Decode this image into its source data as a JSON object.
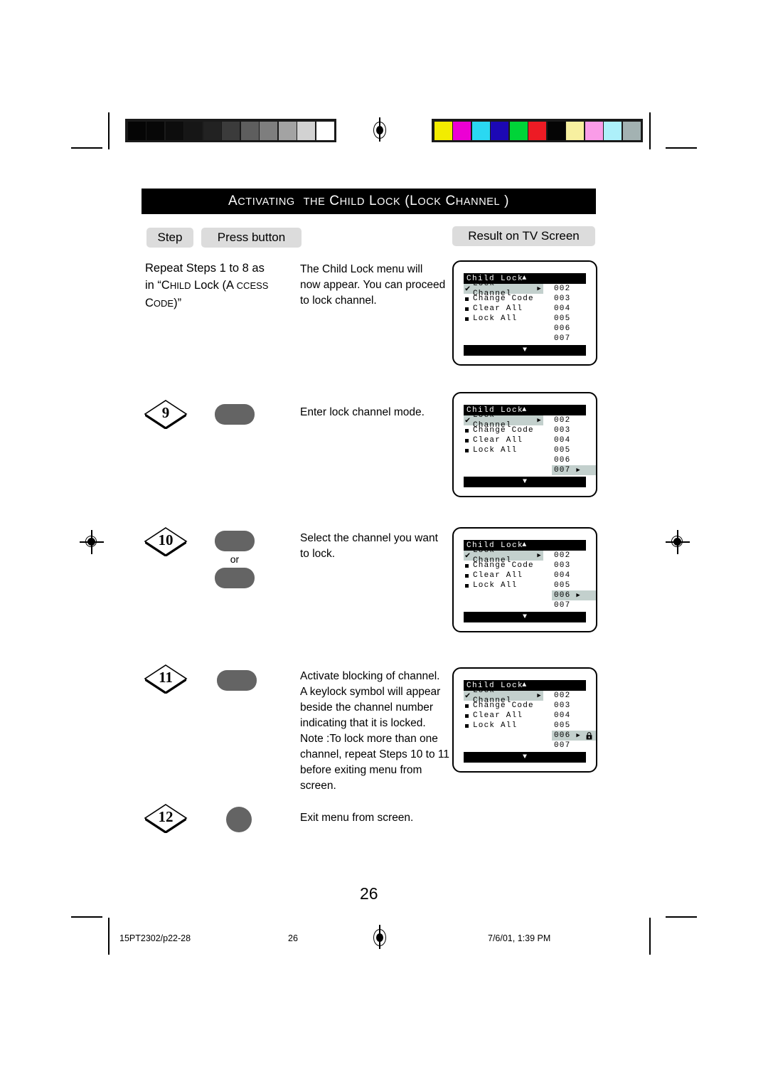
{
  "document": {
    "page_number": "26",
    "footer": {
      "file_ref": "15PT2302/p22-28",
      "page": "26",
      "timestamp": "7/6/01, 1:39 PM"
    }
  },
  "header": {
    "title_parts": {
      "a": "A",
      "ctivating": "CTIVATING",
      "the_big": "T",
      "the_small": "HE",
      "c1": "C",
      "hild": "HILD",
      "l1": "L",
      "ock": "OCK",
      "paren_open": "(",
      "l2": "L",
      "ock2": "OCK",
      "c2": "C",
      "hannel": "HANNEL",
      "paren_close": ")"
    },
    "title_plain": "ACTIVATING THE CHILD LOCK (LOCK CHANNEL )"
  },
  "columns": {
    "step_label": "Step",
    "press_button_label": "Press button",
    "result_label": "Result on TV Screen"
  },
  "calibration": {
    "grayscale": [
      "#050505",
      "#070707",
      "#0d0d0d",
      "#161616",
      "#222222",
      "#3b3b3b",
      "#5e5e5e",
      "#7e7e7e",
      "#a3a3a3",
      "#d2d2d2",
      "#ffffff"
    ],
    "colors": [
      "#f2ec00",
      "#ec00d4",
      "#2ad8f2",
      "#1c08b4",
      "#00d438",
      "#ed1b24",
      "#050505",
      "#f7f0a0",
      "#fa9ce8",
      "#adf0fa",
      "#a3b2b2"
    ]
  },
  "rows": [
    {
      "step_number": "",
      "instruction_line1": "Repeat Steps 1 to 8 as",
      "instruction_line2_pre": "in “",
      "instruction_child_c": "C",
      "instruction_child_hild": "HILD",
      "instruction_lock": " Lock (A ",
      "instruction_access": "CCESS",
      "instruction_code_c": "C",
      "instruction_code_ode": "ODE",
      "instruction_code_close": ")”",
      "description": "The Child Lock menu will\nnow appear. You can proceed\nto lock channel.",
      "button": "none",
      "tv": {
        "title": "Child Lock",
        "up_arrow": "▲",
        "down_arrow": "▼",
        "menu_items": [
          {
            "label": "Lock Channel",
            "marker": "check",
            "highlighted": true,
            "arrow": true
          },
          {
            "label": "Change Code",
            "marker": "bullet",
            "highlighted": false,
            "arrow": false
          },
          {
            "label": "Clear All",
            "marker": "bullet",
            "highlighted": false,
            "arrow": false
          },
          {
            "label": "Lock All",
            "marker": "bullet",
            "highlighted": false,
            "arrow": false
          }
        ],
        "channels": [
          {
            "value": "002",
            "highlighted": false,
            "arrow": false,
            "lock": false
          },
          {
            "value": "003",
            "highlighted": false,
            "arrow": false,
            "lock": false
          },
          {
            "value": "004",
            "highlighted": false,
            "arrow": false,
            "lock": false
          },
          {
            "value": "005",
            "highlighted": false,
            "arrow": false,
            "lock": false
          },
          {
            "value": "006",
            "highlighted": false,
            "arrow": false,
            "lock": false
          },
          {
            "value": "007",
            "highlighted": false,
            "arrow": false,
            "lock": false
          }
        ]
      }
    },
    {
      "step_number": "9",
      "description": "Enter lock channel mode.",
      "button": "pill",
      "tv": {
        "title": "Child Lock",
        "up_arrow": "▲",
        "down_arrow": "▼",
        "menu_items": [
          {
            "label": "Lock Channel",
            "marker": "check",
            "highlighted": true,
            "arrow": true
          },
          {
            "label": "Change Code",
            "marker": "bullet",
            "highlighted": false,
            "arrow": false
          },
          {
            "label": "Clear All",
            "marker": "bullet",
            "highlighted": false,
            "arrow": false
          },
          {
            "label": "Lock All",
            "marker": "bullet",
            "highlighted": false,
            "arrow": false
          }
        ],
        "channels": [
          {
            "value": "002",
            "highlighted": false,
            "arrow": false,
            "lock": false
          },
          {
            "value": "003",
            "highlighted": false,
            "arrow": false,
            "lock": false
          },
          {
            "value": "004",
            "highlighted": false,
            "arrow": false,
            "lock": false
          },
          {
            "value": "005",
            "highlighted": false,
            "arrow": false,
            "lock": false
          },
          {
            "value": "006",
            "highlighted": false,
            "arrow": false,
            "lock": false
          },
          {
            "value": "007",
            "highlighted": true,
            "arrow": true,
            "lock": false
          }
        ]
      }
    },
    {
      "step_number": "10",
      "description": "Select the channel you want\nto lock.",
      "button": "pill-or-pill",
      "or_label": "or",
      "tv": {
        "title": "Child Lock",
        "up_arrow": "▲",
        "down_arrow": "▼",
        "menu_items": [
          {
            "label": "Lock Channel",
            "marker": "check",
            "highlighted": true,
            "arrow": true
          },
          {
            "label": "Change Code",
            "marker": "bullet",
            "highlighted": false,
            "arrow": false
          },
          {
            "label": "Clear All",
            "marker": "bullet",
            "highlighted": false,
            "arrow": false
          },
          {
            "label": "Lock All",
            "marker": "bullet",
            "highlighted": false,
            "arrow": false
          }
        ],
        "channels": [
          {
            "value": "002",
            "highlighted": false,
            "arrow": false,
            "lock": false
          },
          {
            "value": "003",
            "highlighted": false,
            "arrow": false,
            "lock": false
          },
          {
            "value": "004",
            "highlighted": false,
            "arrow": false,
            "lock": false
          },
          {
            "value": "005",
            "highlighted": false,
            "arrow": false,
            "lock": false
          },
          {
            "value": "006",
            "highlighted": true,
            "arrow": true,
            "lock": false
          },
          {
            "value": "007",
            "highlighted": false,
            "arrow": false,
            "lock": false
          }
        ]
      }
    },
    {
      "step_number": "11",
      "description": "Activate blocking of channel.\nA keylock symbol will appear\nbeside the channel number\nindicating that it is locked.\nNote  :To lock more than one\nchannel, repeat Steps 10 to 11\nbefore exiting menu from\nscreen.",
      "button": "pill",
      "tv": {
        "title": "Child Lock",
        "up_arrow": "▲",
        "down_arrow": "▼",
        "menu_items": [
          {
            "label": "Lock Channel",
            "marker": "check",
            "highlighted": true,
            "arrow": true
          },
          {
            "label": "Change Code",
            "marker": "bullet",
            "highlighted": false,
            "arrow": false
          },
          {
            "label": "Clear All",
            "marker": "bullet",
            "highlighted": false,
            "arrow": false
          },
          {
            "label": "Lock All",
            "marker": "bullet",
            "highlighted": false,
            "arrow": false
          }
        ],
        "channels": [
          {
            "value": "002",
            "highlighted": false,
            "arrow": false,
            "lock": false
          },
          {
            "value": "003",
            "highlighted": false,
            "arrow": false,
            "lock": false
          },
          {
            "value": "004",
            "highlighted": false,
            "arrow": false,
            "lock": false
          },
          {
            "value": "005",
            "highlighted": false,
            "arrow": false,
            "lock": false
          },
          {
            "value": "006",
            "highlighted": true,
            "arrow": true,
            "lock": true
          },
          {
            "value": "007",
            "highlighted": false,
            "arrow": false,
            "lock": false
          }
        ]
      }
    },
    {
      "step_number": "12",
      "description": "Exit menu from screen.",
      "button": "circle",
      "tv": null
    }
  ],
  "icons": {
    "check": "✔",
    "right_arrow": "▶",
    "up_arrow": "▲",
    "down_arrow": "▼",
    "padlock": "padlock-icon"
  },
  "colors": {
    "accent_black": "#000000",
    "pill_gray": "#dcdcdc",
    "button_gray": "#646464",
    "osd_highlight": "#c3d0cd"
  }
}
